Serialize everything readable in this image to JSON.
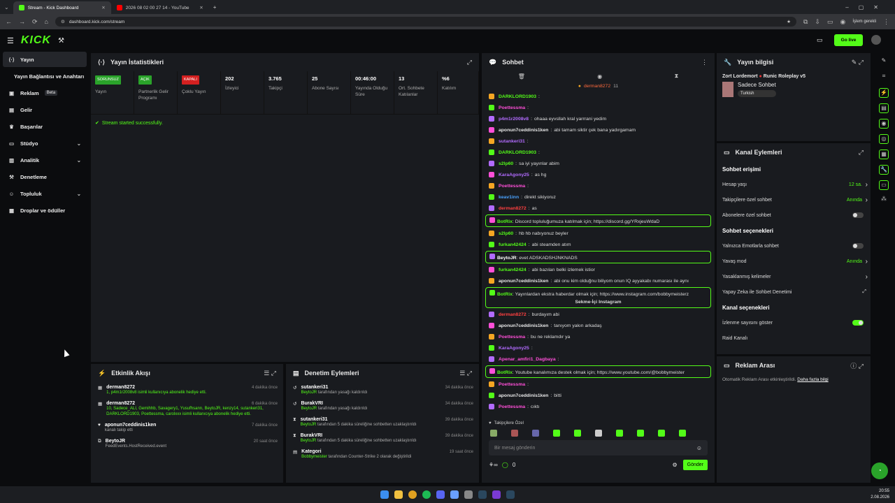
{
  "browser": {
    "tabs": [
      {
        "label": "Stream - Kick Dashboard",
        "active": true
      },
      {
        "label": "2026 08 02 00 27 14 - YouTube",
        "active": false
      }
    ],
    "url": "dashboard.kick.com/stream",
    "profile": "İşlem gerekli"
  },
  "header": {
    "logo": "KICK",
    "golive": "Go live"
  },
  "sidebar": {
    "items": [
      {
        "label": "Yayın",
        "icon": "broadcast-icon",
        "active": true
      },
      {
        "label": "Yayın Bağlantısı ve Anahtarı",
        "icon": "",
        "sub": true
      },
      {
        "label": "Reklam",
        "icon": "megaphone-icon",
        "beta": "Beta"
      },
      {
        "label": "Gelir",
        "icon": "money-icon"
      },
      {
        "label": "Başarılar",
        "icon": "trophy-icon"
      },
      {
        "label": "Stüdyo",
        "icon": "studio-icon",
        "chev": true
      },
      {
        "label": "Analitik",
        "icon": "chart-icon",
        "chev": true
      },
      {
        "label": "Denetleme",
        "icon": "hammer-icon"
      },
      {
        "label": "Topluluk",
        "icon": "community-icon",
        "chev": true
      },
      {
        "label": "Droplar ve ödüller",
        "icon": "gift-icon"
      }
    ]
  },
  "stats": {
    "title": "Yayın İstatistikleri",
    "cells": [
      {
        "badge": "SORUNSUZ",
        "badge_color": "#2aa32a",
        "label": "Yayın"
      },
      {
        "badge": "AÇIK",
        "badge_color": "#2aa32a",
        "label": "Partnerlik Gelir Programı"
      },
      {
        "badge": "KAPALI",
        "badge_color": "#d42020",
        "label": "Çoklu Yayın"
      },
      {
        "value": "202",
        "label": "İzleyici"
      },
      {
        "value": "3.765",
        "label": "Takipçi"
      },
      {
        "value": "25",
        "label": "Abone Sayısı"
      },
      {
        "value": "00:46:00",
        "label": "Yayında Olduğu Süre"
      },
      {
        "value": "13",
        "label": "Ort. Sohbete Katılanlar"
      },
      {
        "value": "%6",
        "label": "Katılım"
      }
    ],
    "message": "Stream started successfully."
  },
  "activity": {
    "title": "Etkinlik Akışı",
    "events": [
      {
        "user": "derman8272",
        "time": "4 dakika önce",
        "text": "1, p4m1r2008v8 isimli kullanıcıya abonelik hediye etti.",
        "icon": "gift-icon"
      },
      {
        "user": "derman8272",
        "time": "6 dakika önce",
        "text": "10, Sadece_ALI, Gemihhb, Savagery1, Yusufhsann, BeytoJR, kenzy14, sutankeri31, DARKLORD1903, Poettessma, carolxxx isimli kullanıcıya abonelik hediye etti.",
        "icon": "gift-icon"
      },
      {
        "user": "aponun7ceddinis1ken",
        "time": "7 dakika önce",
        "text": "kanalı takip etti",
        "icon": "heart-icon"
      },
      {
        "user": "BeytoJR",
        "time": "20 saat önce",
        "text": "FeedEvents.HostReceived.event",
        "icon": "host-icon"
      }
    ]
  },
  "moderation": {
    "title": "Denetim Eylemleri",
    "events": [
      {
        "user": "sutankeri31",
        "time": "34 dakika önce",
        "by": "BeytoJR",
        "text": "tarafından yasağı kaldırıldı",
        "icon": "undo-icon"
      },
      {
        "user": "BurakVRI",
        "time": "34 dakika önce",
        "by": "BeytoJR",
        "text": "tarafından yasağı kaldırıldı",
        "icon": "undo-icon"
      },
      {
        "user": "sutankeri31",
        "time": "39 dakika önce",
        "by": "BeytoJR",
        "text": "tarafından 5 dakika süreliğine sohbetten uzaklaştırıldı",
        "icon": "timer-icon"
      },
      {
        "user": "BurakVRI",
        "time": "39 dakika önce",
        "by": "BeytoJR",
        "text": "tarafından 5 dakika süreliğine sohbetten uzaklaştırıldı",
        "icon": "timer-icon"
      },
      {
        "user": "Kategori",
        "time": "19 saat önce",
        "by": "Bobbymeister",
        "text": "tarafından Counter-Strike 2 olarak değiştirildi",
        "icon": "category-icon"
      }
    ]
  },
  "chat": {
    "title": "Sohbet",
    "pinned": "derman8272",
    "pinned_count": "11",
    "placeholder": "Bir mesaj gönderin",
    "send": "Gönder",
    "followers_only": "Takipçilere Özel",
    "count": "0",
    "messages": [
      {
        "user": "DARKLORD1903",
        "color": "#53fc18",
        "text": ""
      },
      {
        "user": "Poettessma",
        "color": "#ff4fd8",
        "text": ""
      },
      {
        "user": "p4m1r2008v8",
        "color": "#b26bff",
        "text": "ohaaa eyvsllah kral yarrrani yedim"
      },
      {
        "user": "aponun7ceddinis1ken",
        "color": "#e8e8e8",
        "text": "abi tamam siktir çek bana yadırgamam"
      },
      {
        "user": "sutankeri31",
        "color": "#b26bff",
        "text": ""
      },
      {
        "user": "DARKLORD1903",
        "color": "#53fc18",
        "text": ""
      },
      {
        "user": "s2lp60",
        "color": "#53fc18",
        "text": "sa iyi yayınlar abim"
      },
      {
        "user": "KaraAgony25",
        "color": "#b26bff",
        "text": "as hg"
      },
      {
        "user": "Poettessma",
        "color": "#ff4fd8",
        "text": ""
      },
      {
        "user": "keav1inn",
        "color": "#4aa3ff",
        "text": "direkt sikiyoruz"
      },
      {
        "user": "derman8272",
        "color": "#ff4040",
        "text": "as"
      },
      {
        "user": "BotRix",
        "color": "#53fc18",
        "text": "Discord topluluğumuza katılmak için; https://discord.gg/YRxjeuWdaD",
        "hl": true
      },
      {
        "user": "s2lp60",
        "color": "#53fc18",
        "text": "hb hb nabıyonuz beyler"
      },
      {
        "user": "furkan42424",
        "color": "#53fc18",
        "text": "abi steamden atım"
      },
      {
        "user": "BeytoJR",
        "color": "#ffffff",
        "text": "evet ADSKADSHJNKNADS",
        "hl": true
      },
      {
        "user": "furkan42424",
        "color": "#53fc18",
        "text": "abi bazıları belki izlemek istior"
      },
      {
        "user": "aponun7ceddinis1ken",
        "color": "#e8e8e8",
        "text": "abi onu kim olduğnu biliyom onun IQ ayyakabı numarası ile aynı"
      },
      {
        "user": "BotRix",
        "color": "#53fc18",
        "text": "Yayınlardan ekstra haberdar olmak için; https://www.instagram.com/bobbymeisterz",
        "hl": true,
        "button": "Sekme-İçi Instagram"
      },
      {
        "user": "derman8272",
        "color": "#ff4040",
        "text": "burdayım abi"
      },
      {
        "user": "aponun7ceddinis1ken",
        "color": "#e8e8e8",
        "text": "tanıyom yakın arkadaş"
      },
      {
        "user": "Poettessma",
        "color": "#ff4fd8",
        "text": "bu ne reklamdır ya"
      },
      {
        "user": "KaraAgony25",
        "color": "#b26bff",
        "text": ""
      },
      {
        "user": "Apenar_amfiri1_Dagbaya",
        "color": "#ff4fd8",
        "text": ""
      },
      {
        "user": "BotRix",
        "color": "#53fc18",
        "text": "Youtube kanalımıza destek olmak için; https://www.youtube.com/@bobbymeister",
        "hl": true
      },
      {
        "user": "Poettessma",
        "color": "#ff4fd8",
        "text": ""
      },
      {
        "user": "aponun7ceddinis1ken",
        "color": "#e8e8e8",
        "text": "bitti"
      },
      {
        "user": "Poettessma",
        "color": "#ff4fd8",
        "text": "cıktı"
      }
    ]
  },
  "info": {
    "title": "Yayın bilgisi",
    "streamer": "Zort Lordemort",
    "game": "Runic Roleplay v5",
    "category": "Sadece Sohbet",
    "tag": "Turkish"
  },
  "actions": {
    "title": "Kanal Eylemleri",
    "sections": [
      {
        "title": "Sohbet erişimi",
        "items": [
          {
            "label": "Hesap yaşı",
            "value": "12 sa.",
            "chev": true
          },
          {
            "label": "Takipçilere özel sohbet",
            "value": "Anında",
            "chev": true
          },
          {
            "label": "Abonelere özel sohbet",
            "toggle": false
          }
        ]
      },
      {
        "title": "Sohbet seçenekleri",
        "items": [
          {
            "label": "Yalnızca Emotlarla sohbet",
            "toggle": false
          },
          {
            "label": "Yavaş mod",
            "value": "Anında",
            "chev": true
          },
          {
            "label": "Yasaklanmış kelimeler",
            "chev": true
          },
          {
            "label": "Yapay Zeka ile Sohbet Denetimi",
            "ext": true
          }
        ]
      },
      {
        "title": "Kanal seçenekleri",
        "items": [
          {
            "label": "İzlenme sayısını göster",
            "toggle": true
          },
          {
            "label": "Raid Kanalı"
          }
        ]
      }
    ]
  },
  "ads": {
    "title": "Reklam Arası",
    "text": "Otomatik Reklam Arası etkinleştirildi.",
    "link": "Daha fazla bilgi"
  },
  "clock": {
    "time": "20:55",
    "date": "2.08.2026"
  }
}
